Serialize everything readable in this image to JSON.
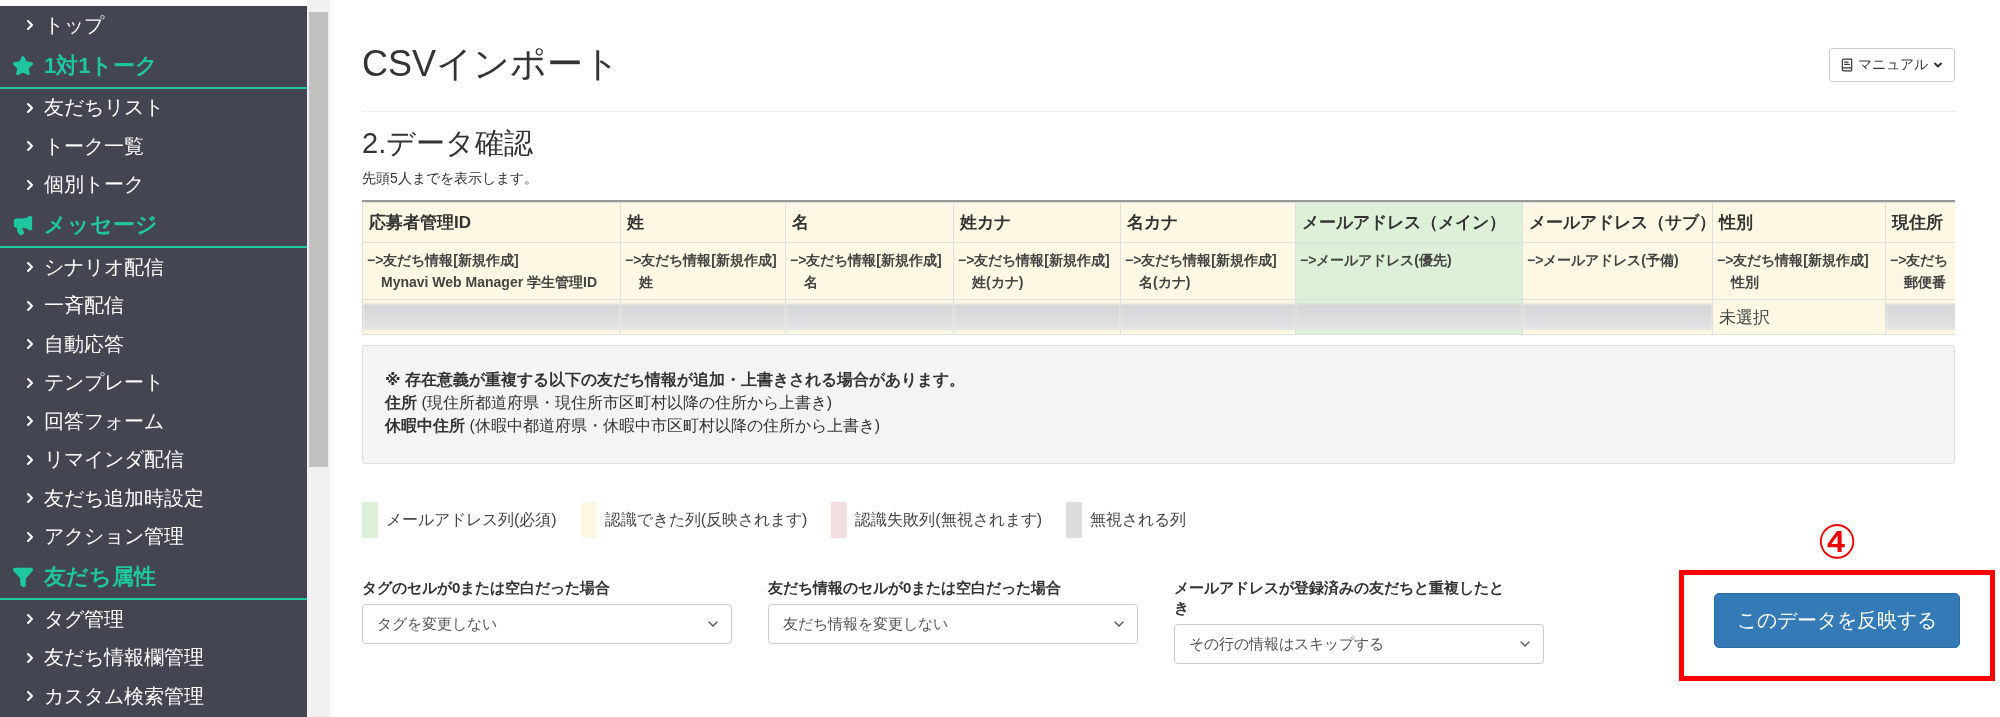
{
  "sidebar": {
    "items": [
      {
        "kind": "link",
        "label": "トップ"
      },
      {
        "kind": "header",
        "label": "1対1トーク"
      },
      {
        "kind": "link",
        "label": "友だちリスト"
      },
      {
        "kind": "link",
        "label": "トーク一覧"
      },
      {
        "kind": "link",
        "label": "個別トーク"
      },
      {
        "kind": "header",
        "label": "メッセージ"
      },
      {
        "kind": "link",
        "label": "シナリオ配信"
      },
      {
        "kind": "link",
        "label": "一斉配信"
      },
      {
        "kind": "link",
        "label": "自動応答"
      },
      {
        "kind": "link",
        "label": "テンプレート"
      },
      {
        "kind": "link",
        "label": "回答フォーム"
      },
      {
        "kind": "link",
        "label": "リマインダ配信"
      },
      {
        "kind": "link",
        "label": "友だち追加時設定"
      },
      {
        "kind": "link",
        "label": "アクション管理"
      },
      {
        "kind": "header",
        "label": "友だち属性"
      },
      {
        "kind": "link",
        "label": "タグ管理"
      },
      {
        "kind": "link",
        "label": "友だち情報欄管理"
      },
      {
        "kind": "link",
        "label": "カスタム検索管理"
      }
    ]
  },
  "page": {
    "title": "CSVインポート",
    "manual_button": "マニュアル",
    "section_title": "2.データ確認",
    "note": "先頭5人までを表示します。"
  },
  "table": {
    "columns": [
      {
        "header": "応募者管理ID",
        "color": "#fcf8e3",
        "mapping": "−>友だち情報[新規作成]",
        "field": "Mynavi Web Manager 学生管理ID"
      },
      {
        "header": "姓",
        "color": "#fcf8e3",
        "mapping": "−>友だち情報[新規作成]",
        "field": "姓"
      },
      {
        "header": "名",
        "color": "#fcf8e3",
        "mapping": "−>友だち情報[新規作成]",
        "field": "名"
      },
      {
        "header": "姓カナ",
        "color": "#fcf8e3",
        "mapping": "−>友だち情報[新規作成]",
        "field": "姓(カナ)"
      },
      {
        "header": "名カナ",
        "color": "#fcf8e3",
        "mapping": "−>友だち情報[新規作成]",
        "field": "名(カナ)"
      },
      {
        "header": "メールアドレス（メイン）",
        "color": "#dff0d8",
        "mapping": "−>メールアドレス(優先)"
      },
      {
        "header": "メールアドレス（サブ）",
        "color": "#fcf8e3",
        "mapping": "−>メールアドレス(予備)"
      },
      {
        "header": "性別",
        "color": "#fcf8e3",
        "mapping": "−>友だち情報[新規作成]",
        "field": "性別"
      },
      {
        "header": "現住所",
        "color": "#fcf8e3",
        "mapping": "−>友だち",
        "field": "郵便番"
      }
    ],
    "rows": [
      {
        "cells": [
          {
            "kind": "redacted"
          },
          {
            "kind": "redacted"
          },
          {
            "kind": "redacted"
          },
          {
            "kind": "redacted"
          },
          {
            "kind": "redacted"
          },
          {
            "kind": "redacted"
          },
          {
            "kind": "redacted"
          },
          {
            "kind": "text",
            "text": "未選択"
          },
          {
            "kind": "redacted"
          }
        ]
      }
    ]
  },
  "notice": {
    "heading": "※ 存在意義が重複する以下の友だち情報が追加・上書きされる場合があります。",
    "lines": [
      "**住所** (現住所都道府県・現住所市区町村以降の住所から上書き)",
      "**休暇中住所** (休暇中都道府県・休暇中市区町村以降の住所から上書き)"
    ]
  },
  "legend": [
    {
      "label": "メールアドレス列(必須)",
      "color": "#dff0d8"
    },
    {
      "label": "認識できた列(反映されます)",
      "color": "#fcf8e3"
    },
    {
      "label": "認識失敗列(無視されます)",
      "color": "#f2dede"
    },
    {
      "label": "無視される列",
      "color": "#dddddd"
    }
  ],
  "options": [
    {
      "label": "タグのセルが0または空白だった場合",
      "value": "タグを変更しない"
    },
    {
      "label": "友だち情報のセルが0または空白だった場合",
      "value": "友だち情報を変更しない"
    },
    {
      "label": "メールアドレスが登録済みの友だちと重複したとき",
      "value": "その行の情報はスキップする"
    }
  ],
  "step_marker": "④",
  "apply_button": "このデータを反映する"
}
